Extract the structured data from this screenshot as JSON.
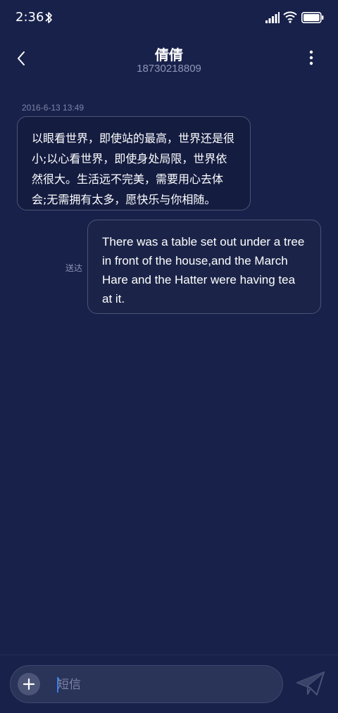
{
  "status_bar": {
    "time": "2:36",
    "icons": [
      "bluetooth-icon",
      "signal-icon",
      "wifi-icon",
      "battery-icon"
    ]
  },
  "header": {
    "contact_name": "倩倩",
    "contact_number": "18730218809",
    "icons": [
      "back-icon",
      "more-vertical-icon"
    ]
  },
  "conversation": {
    "timestamp": "2016-6-13 13:49",
    "messages": [
      {
        "direction": "incoming",
        "lines": [
          "以眼看世界，即使站的最高，世界还是很",
          "小;以心看世界，即使身处局限，世界依",
          "然很大。生活远不完美，需要用心去体",
          "会;无需拥有太多，愿快乐与你相随。"
        ]
      },
      {
        "direction": "outgoing",
        "lines": [
          "There was a table set out under a tree",
          "in front of the house,and the March",
          "Hare and the Hatter were having tea",
          "at it."
        ],
        "status": "送达"
      }
    ]
  },
  "composer": {
    "placeholder": "短信",
    "value": "",
    "icons": [
      "plus-icon",
      "send-icon"
    ]
  },
  "colors": {
    "background": "#18214a",
    "bubble_border": "#4b5478",
    "secondary_text": "#8d95b8",
    "caret": "#2f7ff2"
  }
}
